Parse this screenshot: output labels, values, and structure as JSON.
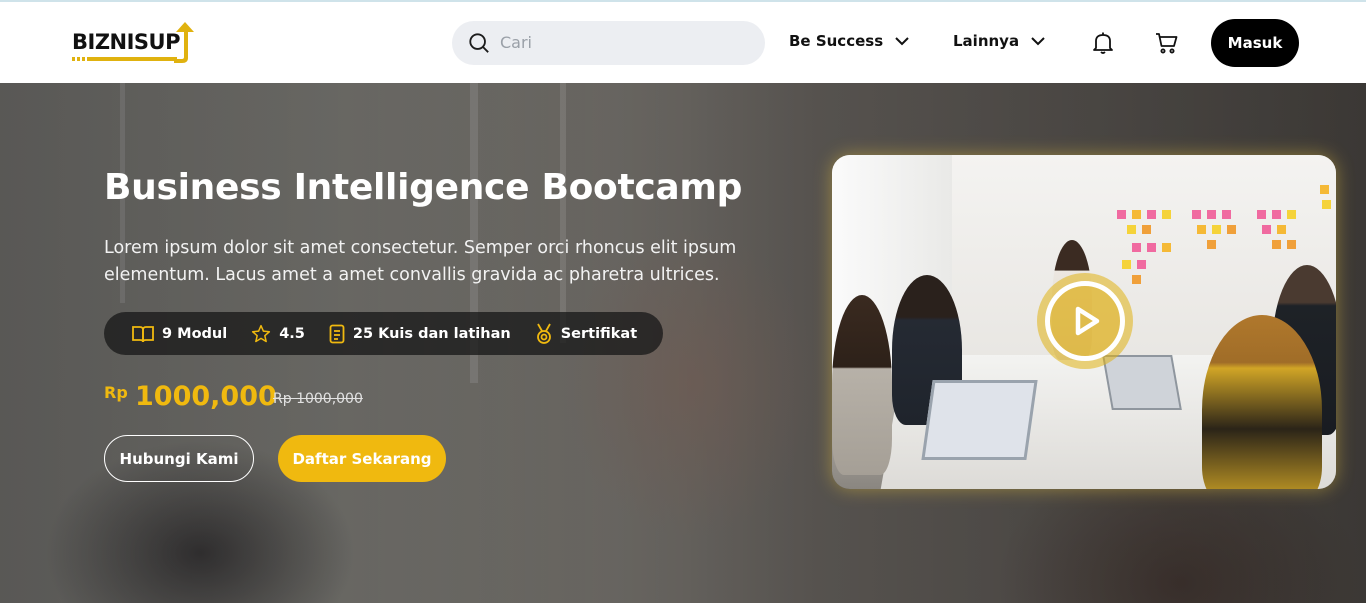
{
  "header": {
    "logo_text": "BIZNISUP",
    "search": {
      "placeholder": "Cari"
    },
    "menus": [
      {
        "label": "Be Success"
      },
      {
        "label": "Lainnya"
      }
    ],
    "login_label": "Masuk"
  },
  "hero": {
    "title": "Business Intelligence Bootcamp",
    "description": "Lorem ipsum dolor sit amet consectetur. Semper orci rhoncus elit ipsum elementum. Lacus amet a amet convallis gravida ac pharetra ultrices.",
    "stats": [
      {
        "icon": "book-icon",
        "label": "9 Modul"
      },
      {
        "icon": "star-icon",
        "label": "4.5"
      },
      {
        "icon": "document-icon",
        "label": "25 Kuis dan latihan"
      },
      {
        "icon": "medal-icon",
        "label": "Sertifikat"
      }
    ],
    "price": {
      "currency": "Rp",
      "amount": "1000,000",
      "old": "Rp 1000,000"
    },
    "buttons": {
      "contact": "Hubungi Kami",
      "register": "Daftar Sekarang"
    }
  },
  "colors": {
    "accent": "#f0b90f",
    "dark": "#000000",
    "search_bg": "#eceef2"
  }
}
